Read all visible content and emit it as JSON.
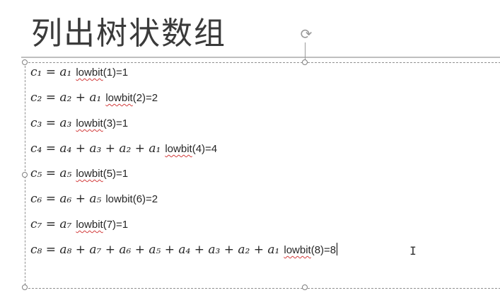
{
  "slide": {
    "title": "列出树状数组",
    "rotate_icon": "rotate-handle-icon",
    "cursor_icon": "text-ibeam-cursor-icon"
  },
  "lines": [
    {
      "math": "c₁ = a₁",
      "func": "lowbit",
      "args": "(1)=1"
    },
    {
      "math": "c₂ = a₂ + a₁",
      "func": "lowbit",
      "args": "(2)=2"
    },
    {
      "math": "c₃ = a₃",
      "func": "lowbit",
      "args": "(3)=1"
    },
    {
      "math": "c₄ = a₄ + a₃ + a₂ + a₁",
      "func": "lowbit",
      "args": "(4)=4"
    },
    {
      "math": "c₅ = a₅",
      "func": "lowbit",
      "args": "(5)=1"
    },
    {
      "math": "c₆ = a₆ + a₅",
      "func": "lowbit",
      "args": "(6)=2"
    },
    {
      "math": "c₇ = a₇",
      "func": "lowbit",
      "args": "(7)=1"
    },
    {
      "math": "c₈ = a₈ + a₇ + a₆ + a₅ + a₄ + a₃ + a₂ + a₁",
      "func": "lowbit",
      "args": "(8)=8"
    }
  ]
}
